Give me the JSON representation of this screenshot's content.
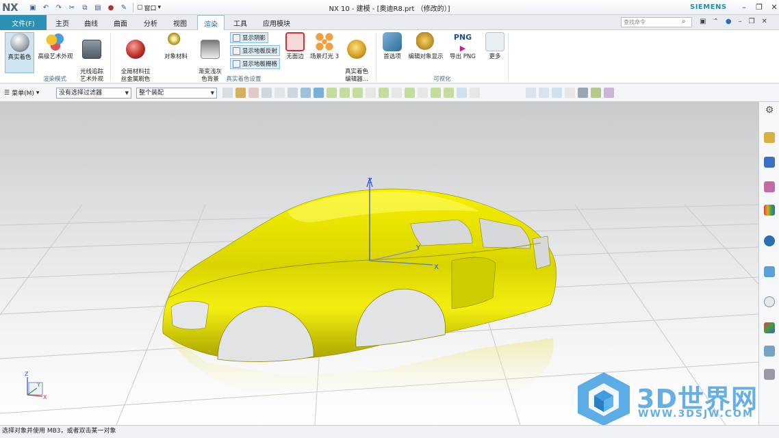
{
  "app": {
    "logo": "NX",
    "title": "NX 10 - 建模 - [奥迪R8.prt （修改的）]",
    "brand": "SIEMENS",
    "window_menu": "窗口"
  },
  "tabs": {
    "file": "文件(F)",
    "items": [
      "主页",
      "曲线",
      "曲面",
      "分析",
      "视图",
      "渲染",
      "工具",
      "应用模块"
    ],
    "active": "渲染"
  },
  "search": {
    "placeholder": "查找命令"
  },
  "ribbon": {
    "render_mode": {
      "label": "渲染模式",
      "buttons": [
        "真实着色",
        "高级艺术外观",
        "光线追踪\n艺术外观"
      ]
    },
    "true_shading": {
      "label": "真实着色设置",
      "buttons": [
        "全局材料拉\n丝金属刷色",
        "对象材料",
        "渐变浅灰\n色背景"
      ],
      "toggles": [
        "显示阴影",
        "显示地板反射",
        "显示地板栅格"
      ],
      "more_buttons": [
        "无面边",
        "场景灯光 3",
        "真实着色\n编辑器..."
      ]
    },
    "visualize": {
      "label": "可视化",
      "buttons": [
        "首选项",
        "编辑对象显示",
        "导出 PNG",
        "更多"
      ],
      "png_text": "PNG"
    }
  },
  "selection_bar": {
    "menu": "菜单(M)",
    "filter": "没有选择过滤器",
    "scope": "整个装配"
  },
  "viewport": {
    "axis_labels": {
      "z": "Z",
      "x": "X",
      "y": "Y"
    },
    "car_color": "#e6e000"
  },
  "status": {
    "message": "选择对象并使用 MB3，或者双击某一对象"
  },
  "watermark": {
    "text": "3D世界网",
    "url": "WWW.3DSJW.COM"
  }
}
